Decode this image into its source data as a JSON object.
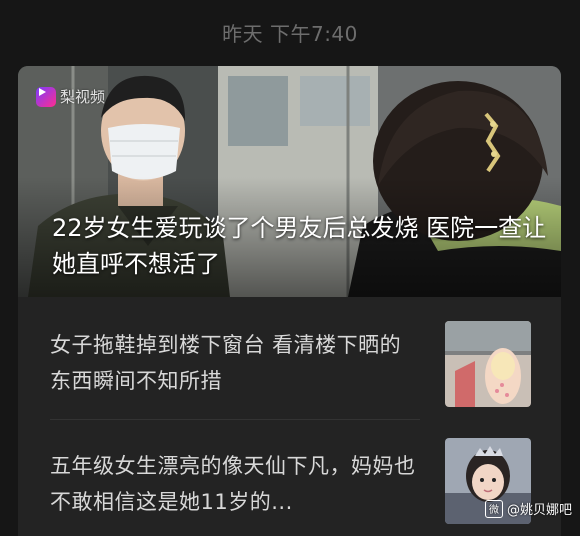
{
  "timestamp": "昨天 下午7:40",
  "card": {
    "source": {
      "name": "梨视频",
      "icon": "video-logo-icon"
    },
    "headline": "22岁女生爱玩谈了个男友后总发烧 医院一查让她直呼不想活了",
    "items": [
      {
        "title": "女子拖鞋掉到楼下窗台 看清楼下晒的东西瞬间不知所措",
        "thumbnail": "slipper-thumbnail"
      },
      {
        "title": "五年级女生漂亮的像天仙下凡，妈妈也不敢相信这是她11岁的...",
        "thumbnail": "girl-portrait-thumbnail"
      }
    ]
  },
  "watermark": {
    "badge": "微",
    "text": "@姚贝娜吧"
  }
}
